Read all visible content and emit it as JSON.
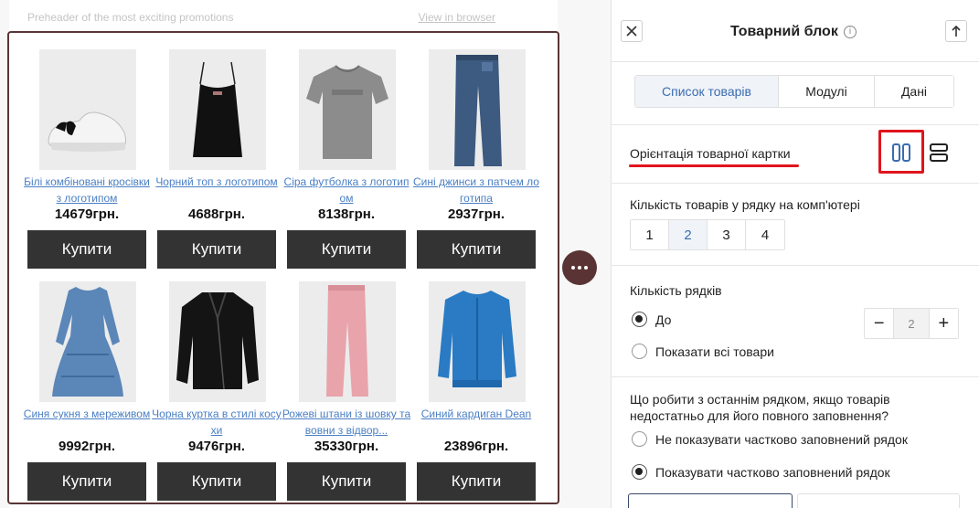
{
  "email": {
    "preheader": "Preheader of the most exciting promotions",
    "view_in_browser": "View in browser",
    "products": [
      {
        "name": "Білі комбіновані кросівки з логотипом",
        "price": "14679грн.",
        "buy": "Купити",
        "image": "sneaker-image"
      },
      {
        "name": "Чорний топ з логотипом",
        "price": "4688грн.",
        "buy": "Купити",
        "image": "top-image"
      },
      {
        "name": "Сіра футболка з логотипом",
        "price": "8138грн.",
        "buy": "Купити",
        "image": "tshirt-image"
      },
      {
        "name": "Сині джинси з патчем логотипа",
        "price": "2937грн.",
        "buy": "Купити",
        "image": "jeans-image"
      },
      {
        "name": "Синя сукня з мереживом",
        "price": "9992грн.",
        "buy": "Купити",
        "image": "dress-image"
      },
      {
        "name": "Чорна куртка в стилі косухи",
        "price": "9476грн.",
        "buy": "Купити",
        "image": "jacket-image"
      },
      {
        "name": "Рожеві штани із шовку та вовни з відвор...",
        "price": "35330грн.",
        "buy": "Купити",
        "image": "pants-image"
      },
      {
        "name": "Синий кардиган Dean",
        "price": "23896грн.",
        "buy": "Купити",
        "image": "cardigan-image"
      }
    ]
  },
  "panel": {
    "title": "Товарний блок",
    "close_icon": "close-icon",
    "collapse_icon": "arrow-up-icon",
    "tabs": [
      {
        "label": "Список товарів",
        "active": true
      },
      {
        "label": "Модулі",
        "active": false
      },
      {
        "label": "Дані",
        "active": false
      }
    ],
    "orientation_label": "Орієнтація товарної картки",
    "desktop_count_label": "Кількість товарів у рядку на комп'ютері",
    "desktop_counts": [
      "1",
      "2",
      "3",
      "4"
    ],
    "desktop_selected": "2",
    "rows_label": "Кількість рядків",
    "rows_options": {
      "upto": "До",
      "all": "Показати всі товари"
    },
    "rows_value": "2",
    "last_row_question": "Що робити з останнім рядком, якщо товарів недостатньо для його повного заповнення?",
    "last_row_options": {
      "hide": "Не показувати частково заповнений рядок",
      "show": "Показувати частково заповнений рядок"
    },
    "accent_color": "#e0141c",
    "active_blue": "#3b6cb0"
  }
}
